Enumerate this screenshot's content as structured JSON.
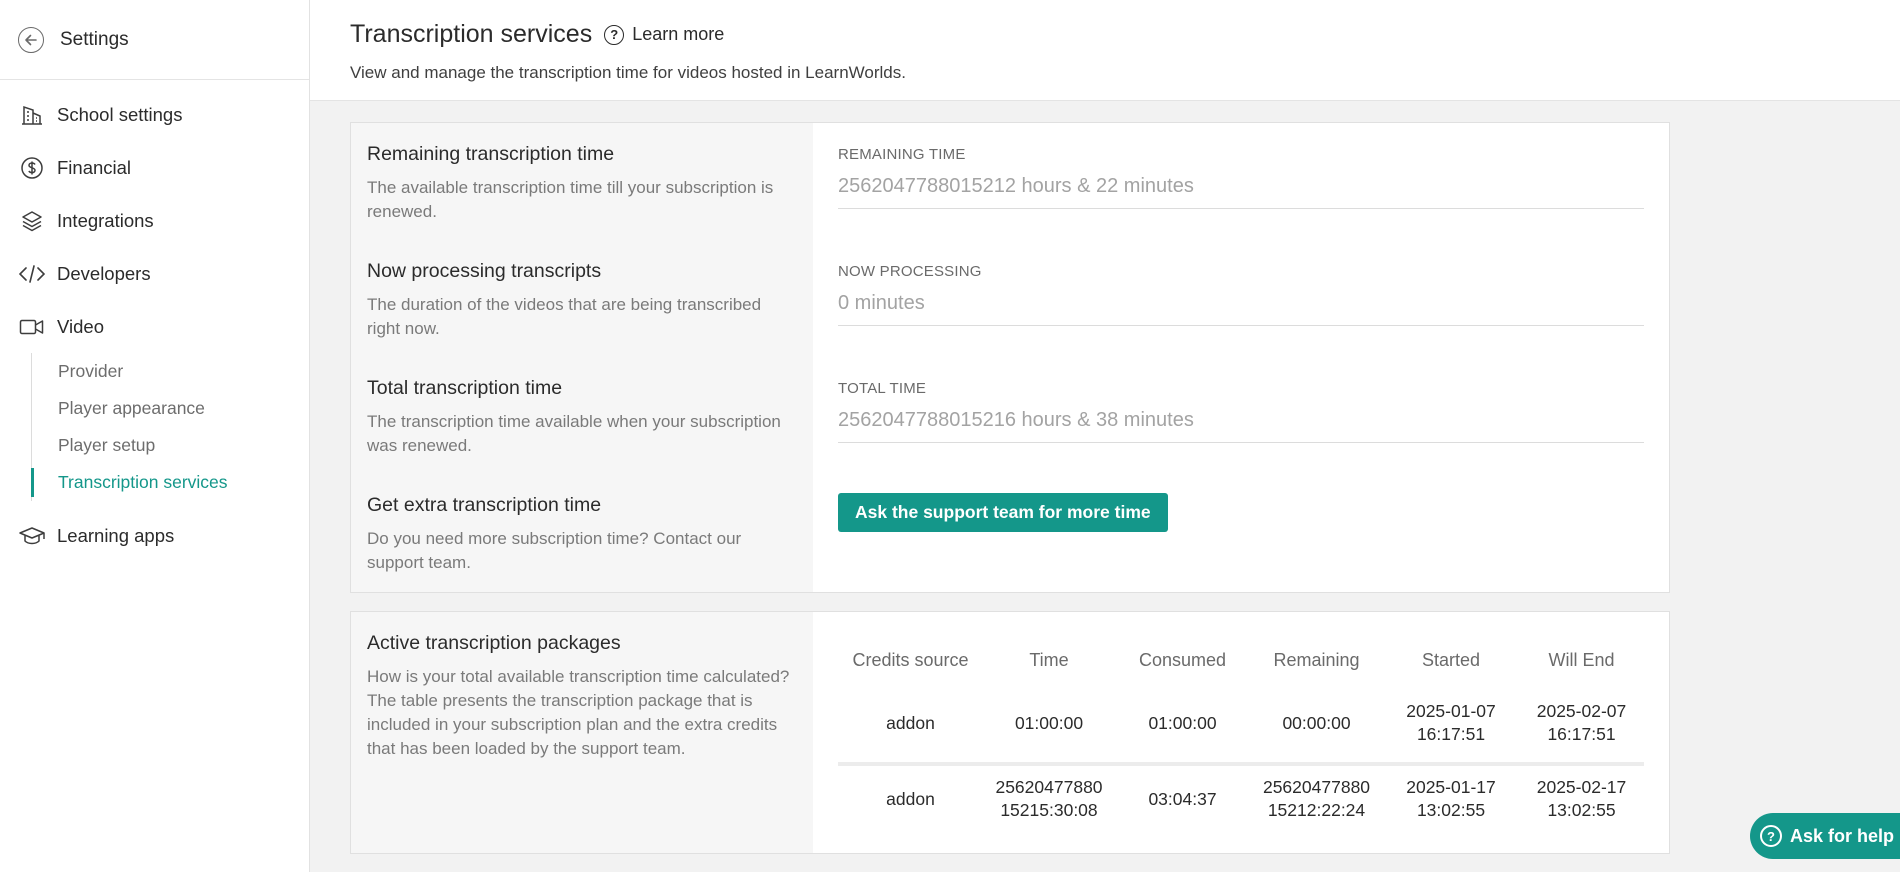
{
  "sidebar": {
    "header_title": "Settings",
    "items": [
      {
        "label": "School settings",
        "icon": "building-icon"
      },
      {
        "label": "Financial",
        "icon": "dollar-icon"
      },
      {
        "label": "Integrations",
        "icon": "layers-icon"
      },
      {
        "label": "Developers",
        "icon": "code-icon"
      },
      {
        "label": "Video",
        "icon": "video-camera-icon"
      },
      {
        "label": "Learning apps",
        "icon": "graduation-cap-icon"
      }
    ],
    "video_subitems": [
      {
        "label": "Provider",
        "active": false
      },
      {
        "label": "Player appearance",
        "active": false
      },
      {
        "label": "Player setup",
        "active": false
      },
      {
        "label": "Transcription services",
        "active": true
      }
    ]
  },
  "header": {
    "title": "Transcription services",
    "learn_more": "Learn more",
    "subtitle": "View and manage the transcription time for videos hosted in LearnWorlds."
  },
  "summary": {
    "remaining": {
      "title": "Remaining transcription time",
      "desc": "The available transcription time till your subscription is renewed.",
      "label": "REMAINING TIME",
      "value": "2562047788015212 hours & 22 minutes"
    },
    "processing": {
      "title": "Now processing transcripts",
      "desc": "The duration of the videos that are being transcribed right now.",
      "label": "NOW PROCESSING",
      "value": "0 minutes"
    },
    "total": {
      "title": "Total transcription time",
      "desc": "The transcription time available when your subscription was renewed.",
      "label": "TOTAL TIME",
      "value": "2562047788015216 hours & 38 minutes"
    },
    "extra": {
      "title": "Get extra transcription time",
      "desc": "Do you need more subscription time? Contact our support team.",
      "button": "Ask the support team for more time"
    }
  },
  "packages": {
    "title": "Active transcription packages",
    "desc": "How is your total available transcription time calculated? The table presents the transcription package that is included in your subscription plan and the extra credits that has been loaded by the support team.",
    "columns": [
      "Credits source",
      "Time",
      "Consumed",
      "Remaining",
      "Started",
      "Will End"
    ],
    "rows": [
      [
        "addon",
        "01:00:00",
        "01:00:00",
        "00:00:00",
        "2025-01-07 16:17:51",
        "2025-02-07 16:17:51"
      ],
      [
        "addon",
        "25620477880 15215:30:08",
        "03:04:37",
        "25620477880 15212:22:24",
        "2025-01-17 13:02:55",
        "2025-02-17 13:02:55"
      ]
    ]
  },
  "help_button": "Ask for help",
  "colors": {
    "accent": "#14978a"
  }
}
